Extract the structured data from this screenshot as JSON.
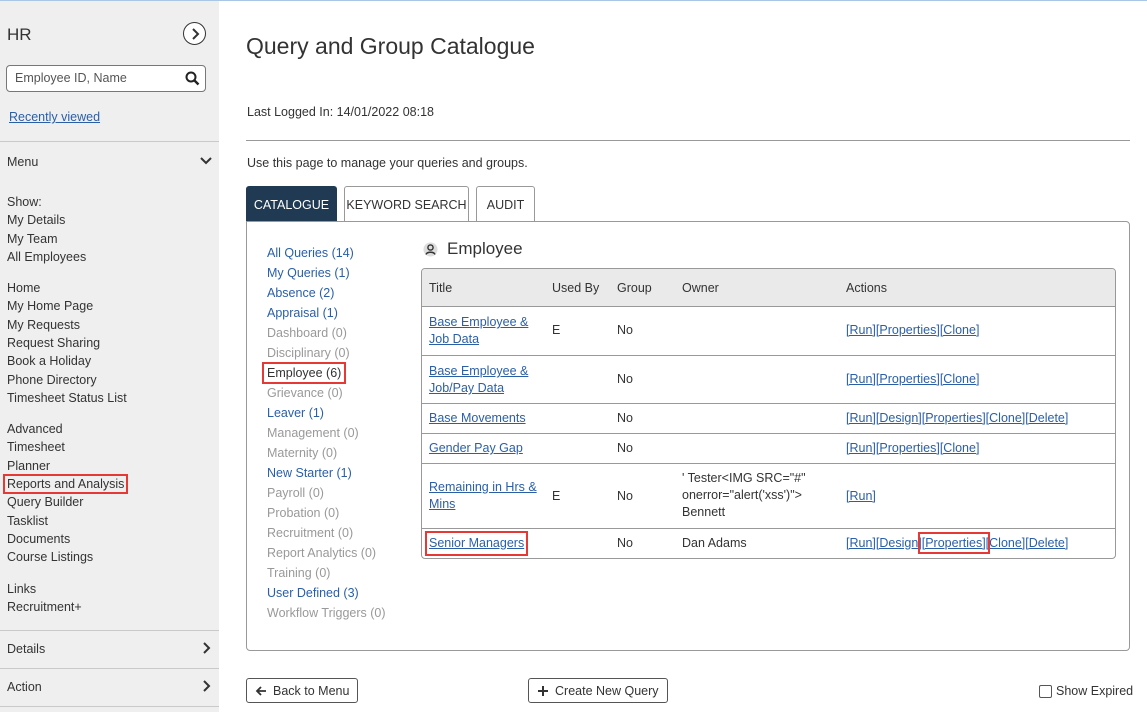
{
  "sidebar": {
    "app_title": "HR",
    "search_placeholder": "Employee ID, Name",
    "recently_viewed": "Recently viewed",
    "menu_label": "Menu",
    "show_title": "Show:",
    "show_items": [
      "My Details",
      "My Team",
      "All Employees"
    ],
    "home_title": "Home",
    "home_items": [
      "My Home Page",
      "My Requests",
      "Request Sharing",
      "Book a Holiday",
      "Phone Directory",
      "Timesheet Status List"
    ],
    "advanced_title": "Advanced",
    "advanced_items": [
      "Timesheet",
      "Planner",
      "Reports and Analysis",
      "Query Builder",
      "Tasklist",
      "Documents",
      "Course Listings"
    ],
    "links_title": "Links",
    "links_items": [
      "Recruitment+"
    ],
    "details_label": "Details",
    "action_label": "Action"
  },
  "page": {
    "title": "Query and Group Catalogue",
    "last_logged_in": "Last Logged In: 14/01/2022 08:18",
    "intro": "Use this page to manage your queries and groups."
  },
  "tabs": [
    "CATALOGUE",
    "KEYWORD SEARCH",
    "AUDIT"
  ],
  "categories": [
    {
      "label": "All Queries (14)",
      "state": "link"
    },
    {
      "label": "My Queries (1)",
      "state": "link"
    },
    {
      "label": "Absence (2)",
      "state": "link"
    },
    {
      "label": "Appraisal (1)",
      "state": "link"
    },
    {
      "label": "Dashboard (0)",
      "state": "disabled"
    },
    {
      "label": "Disciplinary (0)",
      "state": "disabled"
    },
    {
      "label": "Employee (6)",
      "state": "current"
    },
    {
      "label": "Grievance (0)",
      "state": "disabled"
    },
    {
      "label": "Leaver (1)",
      "state": "link"
    },
    {
      "label": "Management (0)",
      "state": "disabled"
    },
    {
      "label": "Maternity (0)",
      "state": "disabled"
    },
    {
      "label": "New Starter (1)",
      "state": "link"
    },
    {
      "label": "Payroll (0)",
      "state": "disabled"
    },
    {
      "label": "Probation (0)",
      "state": "disabled"
    },
    {
      "label": "Recruitment (0)",
      "state": "disabled"
    },
    {
      "label": "Report Analytics (0)",
      "state": "disabled"
    },
    {
      "label": "Training (0)",
      "state": "disabled"
    },
    {
      "label": "User Defined (3)",
      "state": "link"
    },
    {
      "label": "Workflow Triggers (0)",
      "state": "disabled"
    }
  ],
  "section": {
    "title": "Employee"
  },
  "table": {
    "headers": [
      "Title",
      "Used By",
      "Group",
      "Owner",
      "Actions"
    ],
    "rows": [
      {
        "title": "Base Employee & Job Data",
        "used_by": "E",
        "group": "No",
        "owner": "",
        "actions": [
          "[Run]",
          "[Properties]",
          "[Clone]"
        ]
      },
      {
        "title": "Base Employee & Job/Pay Data",
        "used_by": "",
        "group": "No",
        "owner": "",
        "actions": [
          "[Run]",
          "[Properties]",
          "[Clone]"
        ]
      },
      {
        "title": "Base Movements",
        "used_by": "",
        "group": "No",
        "owner": "",
        "actions": [
          "[Run]",
          "[Design]",
          "[Properties]",
          "[Clone]",
          "[Delete]"
        ]
      },
      {
        "title": "Gender Pay Gap",
        "used_by": "",
        "group": "No",
        "owner": "",
        "actions": [
          "[Run]",
          "[Properties]",
          "[Clone]"
        ]
      },
      {
        "title": "Remaining in Hrs & Mins",
        "used_by": "E",
        "group": "No",
        "owner": "' Tester<IMG SRC=\"#\" onerror=\"alert('xss')\"> Bennett",
        "actions": [
          "[Run]"
        ]
      },
      {
        "title": "Senior Managers",
        "used_by": "",
        "group": "No",
        "owner": "Dan Adams",
        "actions": [
          "[Run]",
          "[Design]",
          "[Properties]",
          "[Clone]",
          "[Delete]"
        ]
      }
    ]
  },
  "footer": {
    "back_label": "Back to Menu",
    "create_label": "Create New Query",
    "show_expired_label": "Show Expired"
  },
  "colors": {
    "accent": "#1f3a52",
    "link": "#2a5fa8",
    "highlight": "#e53935"
  }
}
